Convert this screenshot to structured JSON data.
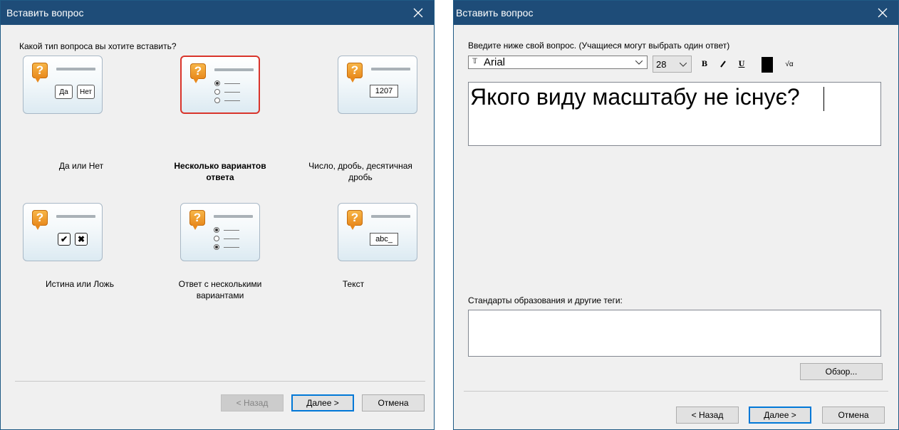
{
  "left_dialog": {
    "title": "Вставить вопрос",
    "prompt": "Какой тип вопроса вы хотите вставить?",
    "types": [
      {
        "label": "Да или Нет",
        "icon": "yes-no",
        "selected": false,
        "mini": [
          "Да",
          "Нет"
        ]
      },
      {
        "label": "Несколько вариантов ответа",
        "icon": "multiple-choice",
        "selected": true
      },
      {
        "label": "Число, дробь, десятичная дробь",
        "icon": "numeric",
        "selected": false,
        "mini": [
          "1207"
        ]
      },
      {
        "label": "Истина или Ложь",
        "icon": "true-false",
        "selected": false
      },
      {
        "label": "Ответ с несколькими вариантами",
        "icon": "multiple-response",
        "selected": false
      },
      {
        "label": "Текст",
        "icon": "text",
        "selected": false,
        "mini": [
          "abc_"
        ]
      }
    ],
    "buttons": {
      "back": "< Назад",
      "next": "Далее >",
      "cancel": "Отмена"
    }
  },
  "right_dialog": {
    "title": "Вставить вопрос",
    "instruction": "Введите ниже свой вопрос. (Учащиеся могут выбрать один ответ)",
    "font_name": "Arial",
    "font_size": "28",
    "toolbar": {
      "bold": "B",
      "italic": "I",
      "underline": "U",
      "color": "#000000",
      "equation": "√α"
    },
    "question_text": "Якого виду масштабу не існує?",
    "tags_label": "Стандарты образования и другие теги:",
    "tags_value": "",
    "browse_button": "Обзор...",
    "buttons": {
      "back": "< Назад",
      "next": "Далее >",
      "cancel": "Отмена"
    }
  },
  "colors": {
    "titlebar": "#1e4c78",
    "selected_border": "#d9342b",
    "default_button": "#0078d7"
  }
}
